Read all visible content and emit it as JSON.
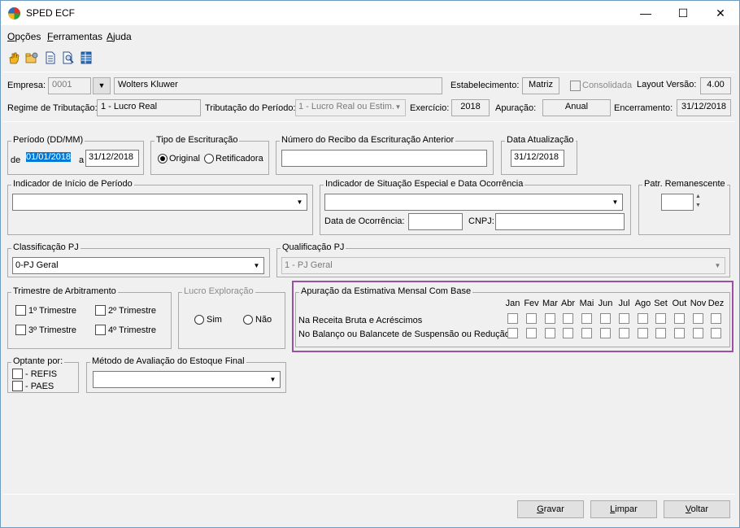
{
  "window": {
    "title": "SPED ECF",
    "minimize": "—",
    "maximize": "☐",
    "close": "✕"
  },
  "menu": [
    {
      "pre": "",
      "acc": "O",
      "post": "pções"
    },
    {
      "pre": "",
      "acc": "F",
      "post": "erramentas"
    },
    {
      "pre": "",
      "acc": "A",
      "post": "juda"
    }
  ],
  "header": {
    "empresa_label": "Empresa:",
    "empresa_code": "0001",
    "empresa_name": "Wolters Kluwer",
    "estabelecimento_label": "Estabelecimento:",
    "estabelecimento_value": "Matriz",
    "consolidada_label": "Consolidada",
    "layout_label": "Layout Versão:",
    "layout_value": "4.00",
    "regime_label": "Regime de Tributação:",
    "regime_value": "1 - Lucro Real",
    "trib_periodo_label": "Tributação do Período:",
    "trib_periodo_value": "1 - Lucro Real ou Estim.",
    "exercicio_label": "Exercício:",
    "exercicio_value": "2018",
    "apuracao_label": "Apuração:",
    "apuracao_value": "Anual",
    "encerramento_label": "Encerramento:",
    "encerramento_value": "31/12/2018"
  },
  "periodo": {
    "title": "Período (DD/MM)",
    "de_label": "de",
    "de_value": "01/01/2018",
    "a_label": "a",
    "a_value": "31/12/2018"
  },
  "tipo": {
    "title": "Tipo de Escrituração",
    "original": "Original",
    "retificadora": "Retificadora"
  },
  "recibo": {
    "title": "Número do Recibo da Escrituração Anterior",
    "value": ""
  },
  "data_atualizacao": {
    "title": "Data Atualização",
    "value": "31/12/2018"
  },
  "indicador_inicio": {
    "title": "Indicador de Início de Período",
    "value": ""
  },
  "indicador_situacao": {
    "title": "Indicador de Situação Especial e Data Ocorrência",
    "value": "",
    "data_label": "Data de Ocorrência:",
    "cnpj_label": "CNPJ:"
  },
  "patr": {
    "title": "Patr. Remanescente",
    "value": ""
  },
  "classificacao": {
    "title": "Classificação PJ",
    "value": "0-PJ Geral"
  },
  "qualificacao": {
    "title": "Qualificação PJ",
    "value": "1 - PJ Geral"
  },
  "trimestre": {
    "title": "Trimestre de Arbitramento",
    "t1": "1º Trimestre",
    "t2": "2º Trimestre",
    "t3": "3º Trimestre",
    "t4": "4º Trimestre"
  },
  "lucro": {
    "title": "Lucro Exploração",
    "sim": "Sim",
    "nao": "Não"
  },
  "apuracao_estimativa": {
    "title": "Apuração da Estimativa Mensal Com Base",
    "months": [
      "Jan",
      "Fev",
      "Mar",
      "Abr",
      "Mai",
      "Jun",
      "Jul",
      "Ago",
      "Set",
      "Out",
      "Nov",
      "Dez"
    ],
    "row1_label": "Na Receita Bruta e Acréscimos",
    "row2_label": "No Balanço ou Balancete de Suspensão ou Redução",
    "highlight_color": "#9b4fa5"
  },
  "optante": {
    "title": "Optante por:",
    "refis": "- REFIS",
    "paes": "- PAES"
  },
  "metodo": {
    "title": "Método de Avaliação do Estoque Final",
    "value": ""
  },
  "buttons": [
    {
      "acc": "G",
      "post": "ravar"
    },
    {
      "acc": "L",
      "post": "impar"
    },
    {
      "acc": "V",
      "post": "oltar"
    }
  ]
}
